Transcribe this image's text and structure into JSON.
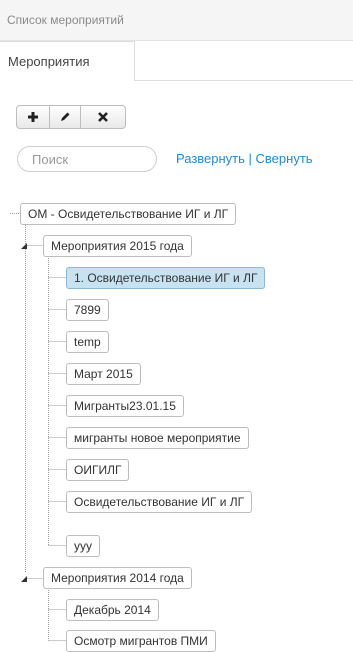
{
  "header": {
    "title": "Список мероприятий"
  },
  "tabs": [
    {
      "label": "Мероприятия"
    }
  ],
  "toolbar": {
    "add_icon": "plus-icon",
    "edit_icon": "pencil-icon",
    "delete_icon": "close-icon"
  },
  "search": {
    "placeholder": "Поиск",
    "value": ""
  },
  "links": {
    "expand": "Развернуть",
    "separator": " | ",
    "collapse": "Свернуть"
  },
  "tree": {
    "root": "ОМ - Освидетельствование ИГ и ЛГ",
    "groups": [
      {
        "label": "Мероприятия 2015 года",
        "expanded": true,
        "items": [
          "1. Освидетельствование ИГ и ЛГ",
          "7899",
          "temp",
          "Март 2015",
          "Мигранты23.01.15",
          "мигранты новое мероприятие",
          "ОИГИЛГ",
          "Освидетельствование ИГ и ЛГ",
          "ууу"
        ],
        "selected_index": 0
      },
      {
        "label": "Мероприятия 2014 года",
        "expanded": true,
        "items": [
          "Декабрь 2014",
          "Осмотр мигрантов ПМИ"
        ]
      }
    ]
  },
  "colors": {
    "link": "#2a87c9",
    "selected": "#c7e2f1",
    "border": "#bdbdbd"
  }
}
